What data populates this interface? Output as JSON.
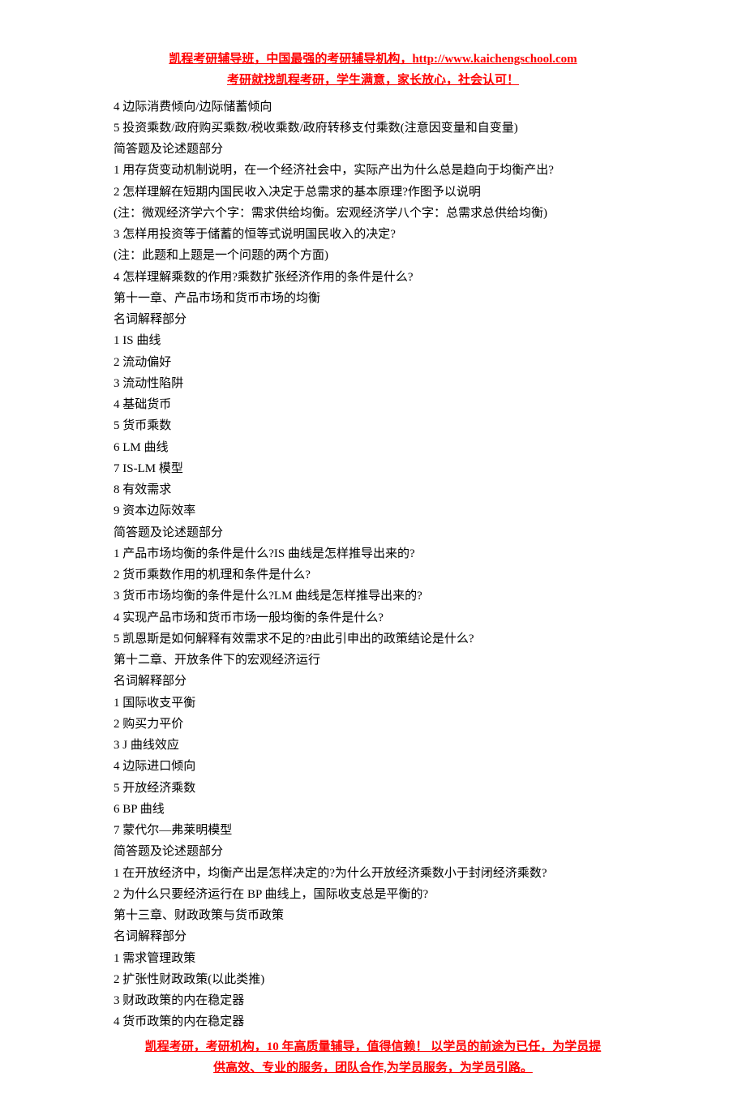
{
  "header": {
    "line1_part1": "凯程考研辅导班，中国最强的考研辅导机构，",
    "line1_link": "http://www.kaichengschool.com",
    "line2": "考研就找凯程考研，学生满意，家长放心，社会认可！"
  },
  "lines": [
    "4 边际消费倾向/边际储蓄倾向",
    "5 投资乘数/政府购买乘数/税收乘数/政府转移支付乘数(注意因变量和自变量)",
    "简答题及论述题部分",
    "1 用存货变动机制说明，在一个经济社会中，实际产出为什么总是趋向于均衡产出?",
    "2 怎样理解在短期内国民收入决定于总需求的基本原理?作图予以说明",
    "(注：微观经济学六个字：需求供给均衡。宏观经济学八个字：总需求总供给均衡)",
    "3 怎样用投资等于储蓄的恒等式说明国民收入的决定?",
    "(注：此题和上题是一个问题的两个方面)",
    "4 怎样理解乘数的作用?乘数扩张经济作用的条件是什么?",
    "第十一章、产品市场和货币市场的均衡",
    "名词解释部分",
    "1 IS 曲线",
    "2 流动偏好",
    "3 流动性陷阱",
    "4 基础货币",
    "5 货币乘数",
    "6 LM 曲线",
    "7 IS-LM 模型",
    "8 有效需求",
    "9 资本边际效率",
    "简答题及论述题部分",
    "1 产品市场均衡的条件是什么?IS 曲线是怎样推导出来的?",
    "2 货币乘数作用的机理和条件是什么?",
    "3 货币市场均衡的条件是什么?LM 曲线是怎样推导出来的?",
    "4 实现产品市场和货币市场一般均衡的条件是什么?",
    "5 凯恩斯是如何解释有效需求不足的?由此引申出的政策结论是什么?",
    "第十二章、开放条件下的宏观经济运行",
    "名词解释部分",
    "1 国际收支平衡",
    "2 购买力平价",
    "3 J 曲线效应",
    "4 边际进口倾向",
    "5 开放经济乘数",
    "6 BP 曲线",
    "7 蒙代尔—弗莱明模型",
    "简答题及论述题部分",
    "1 在开放经济中，均衡产出是怎样决定的?为什么开放经济乘数小于封闭经济乘数?",
    "2 为什么只要经济运行在 BP 曲线上，国际收支总是平衡的?",
    "第十三章、财政政策与货币政策",
    "名词解释部分",
    "1 需求管理政策",
    "2 扩张性财政政策(以此类推)",
    "3 财政政策的内在稳定器",
    "4 货币政策的内在稳定器"
  ],
  "footer": {
    "line1": "凯程考研，考研机构，10 年高质量辅导，值得信赖！  以学员的前途为已任，为学员提",
    "line2": "供高效、专业的服务，团队合作,为学员服务，为学员引路。"
  }
}
